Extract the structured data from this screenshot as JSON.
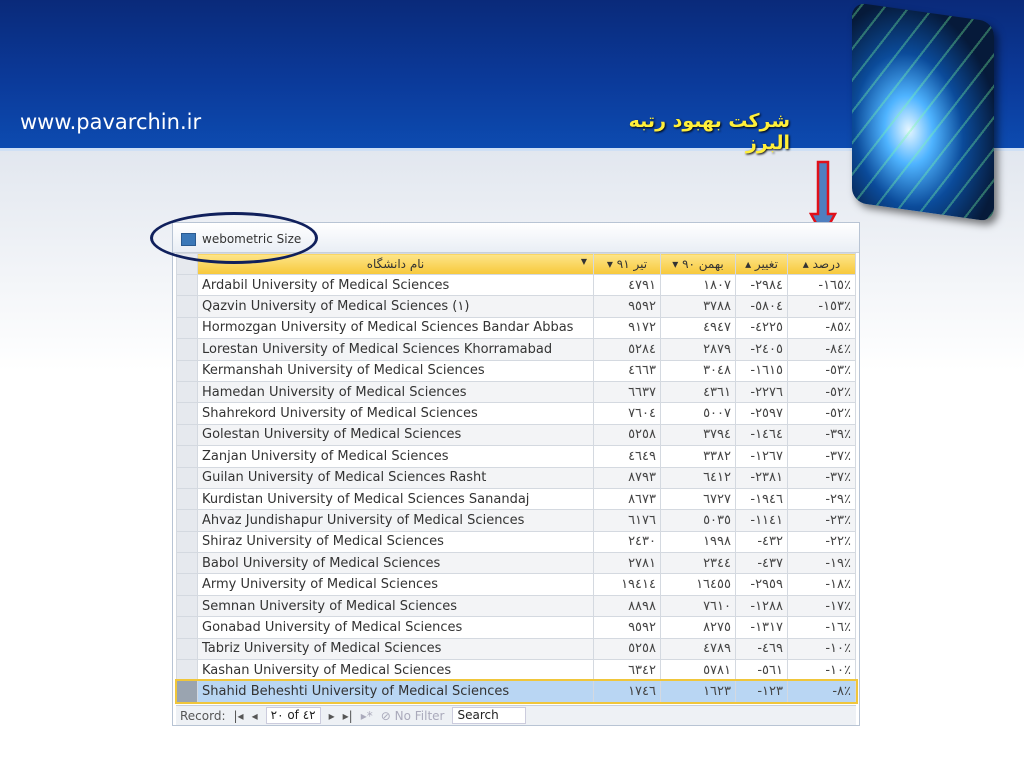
{
  "header": {
    "url": "www.pavarchin.ir",
    "company": "شرکت بهبود رتبه البرز"
  },
  "window": {
    "tab_title": "webometric Size"
  },
  "table": {
    "columns": {
      "name": "نام دانشگاه",
      "tir91": "تیر ۹۱",
      "bahman90": "بهمن ۹۰",
      "change": "تغییر",
      "percent": "درصد"
    },
    "rows": [
      {
        "name": "Ardabil University of Medical Sciences",
        "tir91": "٤٧٩١",
        "bahman90": "١٨٠٧",
        "change": "-٢٩٨٤",
        "percent": "-١٦٥٪"
      },
      {
        "name": "Qazvin University of Medical Sciences (١)",
        "tir91": "٩٥٩٢",
        "bahman90": "٣٧٨٨",
        "change": "-٥٨٠٤",
        "percent": "-١٥٣٪"
      },
      {
        "name": "Hormozgan University of Medical Sciences Bandar Abbas",
        "tir91": "٩١٧٢",
        "bahman90": "٤٩٤٧",
        "change": "-٤٢٢٥",
        "percent": "-٨٥٪"
      },
      {
        "name": "Lorestan University of Medical Sciences Khorramabad",
        "tir91": "٥٢٨٤",
        "bahman90": "٢٨٧٩",
        "change": "-٢٤٠٥",
        "percent": "-٨٤٪"
      },
      {
        "name": "Kermanshah University of Medical Sciences",
        "tir91": "٤٦٦٣",
        "bahman90": "٣٠٤٨",
        "change": "-١٦١٥",
        "percent": "-٥٣٪"
      },
      {
        "name": "Hamedan University of Medical Sciences",
        "tir91": "٦٦٣٧",
        "bahman90": "٤٣٦١",
        "change": "-٢٢٧٦",
        "percent": "-٥٢٪"
      },
      {
        "name": "Shahrekord University of Medical Sciences",
        "tir91": "٧٦٠٤",
        "bahman90": "٥٠٠٧",
        "change": "-٢٥٩٧",
        "percent": "-٥٢٪"
      },
      {
        "name": "Golestan University of Medical Sciences",
        "tir91": "٥٢٥٨",
        "bahman90": "٣٧٩٤",
        "change": "-١٤٦٤",
        "percent": "-٣٩٪"
      },
      {
        "name": "Zanjan University of Medical Sciences",
        "tir91": "٤٦٤٩",
        "bahman90": "٣٣٨٢",
        "change": "-١٢٦٧",
        "percent": "-٣٧٪"
      },
      {
        "name": "Guilan University of Medical Sciences Rasht",
        "tir91": "٨٧٩٣",
        "bahman90": "٦٤١٢",
        "change": "-٢٣٨١",
        "percent": "-٣٧٪"
      },
      {
        "name": "Kurdistan University of Medical Sciences Sanandaj",
        "tir91": "٨٦٧٣",
        "bahman90": "٦٧٢٧",
        "change": "-١٩٤٦",
        "percent": "-٢٩٪"
      },
      {
        "name": "Ahvaz Jundishapur University of Medical Sciences",
        "tir91": "٦١٧٦",
        "bahman90": "٥٠٣٥",
        "change": "-١١٤١",
        "percent": "-٢٣٪"
      },
      {
        "name": "Shiraz University of Medical Sciences",
        "tir91": "٢٤٣٠",
        "bahman90": "١٩٩٨",
        "change": "-٤٣٢",
        "percent": "-٢٢٪"
      },
      {
        "name": "Babol University of Medical Sciences",
        "tir91": "٢٧٨١",
        "bahman90": "٢٣٤٤",
        "change": "-٤٣٧",
        "percent": "-١٩٪"
      },
      {
        "name": "Army University of Medical Sciences",
        "tir91": "١٩٤١٤",
        "bahman90": "١٦٤٥٥",
        "change": "-٢٩٥٩",
        "percent": "-١٨٪"
      },
      {
        "name": "Semnan University of Medical Sciences",
        "tir91": "٨٨٩٨",
        "bahman90": "٧٦١٠",
        "change": "-١٢٨٨",
        "percent": "-١٧٪"
      },
      {
        "name": "Gonabad University of Medical Sciences",
        "tir91": "٩٥٩٢",
        "bahman90": "٨٢٧٥",
        "change": "-١٣١٧",
        "percent": "-١٦٪"
      },
      {
        "name": "Tabriz University of Medical Sciences",
        "tir91": "٥٢٥٨",
        "bahman90": "٤٧٨٩",
        "change": "-٤٦٩",
        "percent": "-١٠٪"
      },
      {
        "name": "Kashan University of Medical Sciences",
        "tir91": "٦٣٤٢",
        "bahman90": "٥٧٨١",
        "change": "-٥٦١",
        "percent": "-١٠٪"
      },
      {
        "name": "Shahid Beheshti University of Medical Sciences",
        "tir91": "١٧٤٦",
        "bahman90": "١٦٢٣",
        "change": "-١٢٣",
        "percent": "-٨٪"
      }
    ]
  },
  "footer": {
    "record_label": "Record:",
    "record_value": "٢٠ of ٤٢",
    "filter": "No Filter",
    "search": "Search"
  }
}
